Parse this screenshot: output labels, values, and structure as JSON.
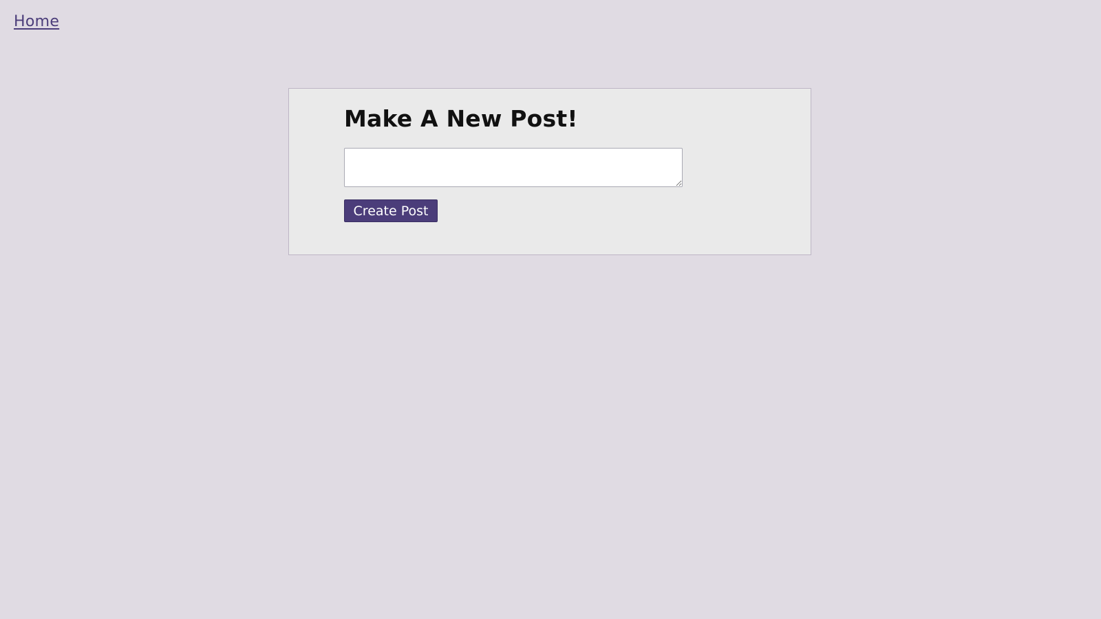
{
  "nav": {
    "home_label": "Home"
  },
  "form": {
    "title": "Make A New Post!",
    "textarea_value": "",
    "submit_label": "Create Post"
  },
  "colors": {
    "page_background": "#e0dbe3",
    "panel_background": "#eaeaea",
    "accent": "#4b3d7a",
    "button_text": "#ffffff",
    "title_text": "#111111"
  }
}
